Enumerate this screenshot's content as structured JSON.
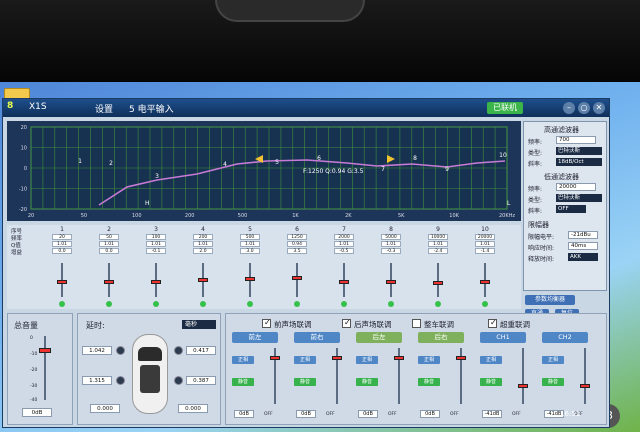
{
  "titlebar": {
    "logo": "8",
    "app_name": "X1S",
    "menu_settings": "设置",
    "menu_level": "5 电平输入",
    "connect_btn": "已联机",
    "min_icon": "minimize-icon",
    "restore_icon": "restore-icon",
    "close_icon": "close-icon"
  },
  "graph": {
    "y_ticks": [
      "20",
      "10",
      "0",
      "-10",
      "-20"
    ],
    "x_ticks": [
      "20",
      "50",
      "100",
      "200",
      "500",
      "1K",
      "2K",
      "5K",
      "10K",
      "20KHz"
    ],
    "readout": "F:1250 Q:0.94 G:3.5",
    "markers": [
      "1",
      "2",
      "3",
      "4",
      "5",
      "6",
      "7",
      "8",
      "9",
      "10"
    ],
    "h_label": "H",
    "l_label": "L",
    "curve_color": "#c77bd6"
  },
  "filters": {
    "hp_title": "高通滤波器",
    "freq_label": "频率:",
    "hp_freq": "700",
    "type_label": "类型:",
    "hp_type": "巴特沃斯",
    "slope_label": "斜率:",
    "hp_slope": "18dB/Oct",
    "lp_title": "低通滤波器",
    "lp_freq": "20000",
    "lp_type": "巴特沃斯",
    "lp_slope": "OFF",
    "limiter_title": "限幅器",
    "lim_level_label": "限幅电平:",
    "lim_level": "-21dBu",
    "lim_attack_label": "响应时间:",
    "lim_attack": "40ms",
    "lim_release_label": "释放时间:",
    "lim_release": "AKK"
  },
  "channel_rows": [
    "序号",
    "频率",
    "Q值",
    "增益"
  ],
  "channels": [
    {
      "num": "1",
      "freq": "20",
      "q": "1.01",
      "gain": "0.0",
      "level": 0.55
    },
    {
      "num": "2",
      "freq": "50",
      "q": "1.01",
      "gain": "0.0",
      "level": 0.55
    },
    {
      "num": "3",
      "freq": "100",
      "q": "1.01",
      "gain": "-0.1",
      "level": 0.55
    },
    {
      "num": "4",
      "freq": "200",
      "q": "1.01",
      "gain": "2.0",
      "level": 0.5
    },
    {
      "num": "5",
      "freq": "500",
      "q": "1.01",
      "gain": "3.0",
      "level": 0.45
    },
    {
      "num": "6",
      "freq": "1250",
      "q": "0.94",
      "gain": "3.5",
      "level": 0.42
    },
    {
      "num": "7",
      "freq": "2000",
      "q": "1.01",
      "gain": "-0.5",
      "level": 0.56
    },
    {
      "num": "8",
      "freq": "5000",
      "q": "1.01",
      "gain": "-0.3",
      "level": 0.55
    },
    {
      "num": "9",
      "freq": "10000",
      "q": "1.01",
      "gain": "-2.4",
      "level": 0.6
    },
    {
      "num": "10",
      "freq": "20000",
      "q": "1.01",
      "gain": "-1.4",
      "level": 0.57
    }
  ],
  "mid_buttons": {
    "eq_reset": "参数均衡器",
    "bypass": "直通",
    "reset": "复位"
  },
  "volume": {
    "title": "总音量",
    "ticks": [
      "0",
      "-10",
      "-20",
      "-30",
      "-40"
    ],
    "value": "0dB",
    "level": 0.2
  },
  "delay": {
    "title": "延时:",
    "unit": "毫秒",
    "fl": "1.042",
    "fr": "0.417",
    "rl": "1.315",
    "rr": "0.387",
    "sl": "0.000",
    "sr": "0.000"
  },
  "links": [
    {
      "label": "前声场联调",
      "checked": true
    },
    {
      "label": "后声场联调",
      "checked": true
    },
    {
      "label": "整车联调",
      "checked": false
    },
    {
      "label": "超重联调",
      "checked": true
    }
  ],
  "outputs": [
    {
      "name": "前左",
      "green": false,
      "btn1": "正相",
      "btn2": "静音",
      "value": "0dB",
      "level": 0.15
    },
    {
      "name": "前右",
      "green": false,
      "btn1": "正相",
      "btn2": "静音",
      "value": "0dB",
      "level": 0.15
    },
    {
      "name": "后左",
      "green": true,
      "btn1": "正相",
      "btn2": "静音",
      "value": "0dB",
      "level": 0.15
    },
    {
      "name": "后右",
      "green": true,
      "btn1": "正相",
      "btn2": "静音",
      "value": "0dB",
      "level": 0.15
    },
    {
      "name": "CH1",
      "green": false,
      "btn1": "正相",
      "btn2": "静音",
      "value": "-41dB",
      "level": 0.7
    },
    {
      "name": "CH2",
      "green": false,
      "btn1": "正相",
      "btn2": "静音",
      "value": "-41dB",
      "level": 0.7
    }
  ],
  "output_unit": "OFF",
  "taskbar": {
    "clock": "16:51",
    "badge": "23"
  }
}
